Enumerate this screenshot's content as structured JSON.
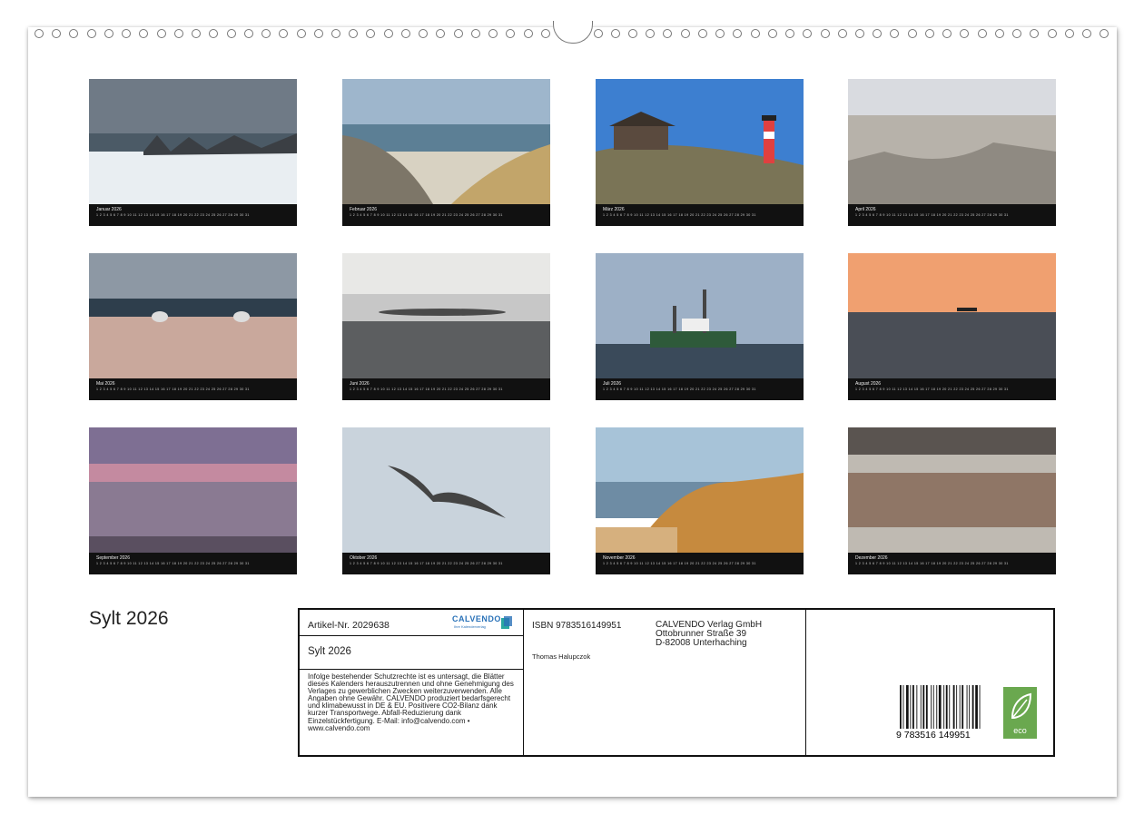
{
  "months": [
    {
      "name": "Januar",
      "year": "2026"
    },
    {
      "name": "Februar",
      "year": "2026"
    },
    {
      "name": "März",
      "year": "2026"
    },
    {
      "name": "April",
      "year": "2026"
    },
    {
      "name": "Mai",
      "year": "2026"
    },
    {
      "name": "Juni",
      "year": "2026"
    },
    {
      "name": "Juli",
      "year": "2026"
    },
    {
      "name": "August",
      "year": "2026"
    },
    {
      "name": "September",
      "year": "2026"
    },
    {
      "name": "Oktober",
      "year": "2026"
    },
    {
      "name": "November",
      "year": "2026"
    },
    {
      "name": "Dezember",
      "year": "2026"
    }
  ],
  "calendar": {
    "title": "Sylt 2026",
    "article": "Artikel-Nr. 2029638",
    "subtitle": "Sylt 2026",
    "brand": "CALVENDO",
    "brand_sub": "Ihre Kalenderverlag",
    "legal": "Infolge bestehender Schutzrechte ist es untersagt, die Blätter dieses Kalenders herauszutrennen und ohne Genehmigung des Verlages zu gewerblichen Zwecken weiterzuverwenden. Alle Angaben ohne Gewähr. CALVENDO produziert bedarfsgerecht und klimabewusst in DE & EU. Positivere CO2-Bilanz dank kurzer Transportwege. Abfall-Reduzierung dank Einzelstückfertigung. E-Mail: info@calvendo.com • www.calvendo.com",
    "isbn": "ISBN 9783516149951",
    "author": "Thomas Halupczok",
    "publisher_line1": "CALVENDO Verlag GmbH",
    "publisher_line2": "Ottobrunner Straße 39",
    "publisher_line3": "D-82008 Unterhaching",
    "barcode_digits": "9 783516 149951",
    "eco_label": "eco"
  }
}
